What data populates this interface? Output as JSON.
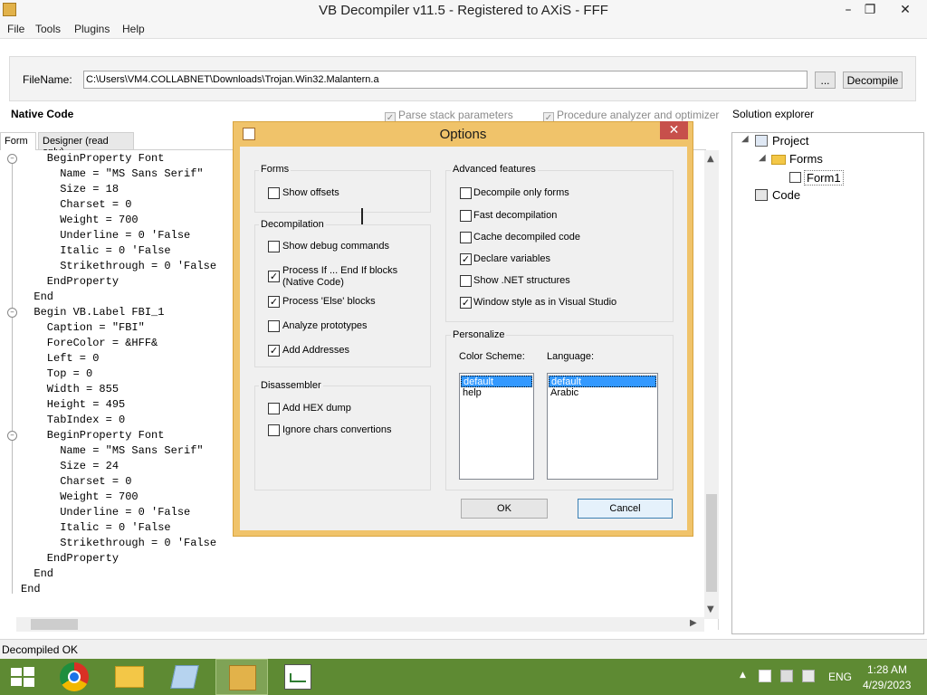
{
  "window": {
    "title": "VB Decompiler v11.5 - Registered to AXiS - FFF"
  },
  "menu": [
    "File",
    "Tools",
    "Plugins",
    "Help"
  ],
  "file_bar": {
    "label": "FileName:",
    "path": "C:\\Users\\VM4.COLLABNET\\Downloads\\Trojan.Win32.Malantern.a",
    "browse_label": "...",
    "decompile_label": "Decompile"
  },
  "header": {
    "native_code": "Native Code",
    "parse_stack": "Parse stack parameters",
    "procedure_analyzer": "Procedure analyzer and optimizer",
    "solution_explorer": "Solution explorer"
  },
  "tabs": [
    "Form",
    "Designer (read only)"
  ],
  "code_lines": [
    "    BeginProperty Font",
    "      Name = \"MS Sans Serif\"",
    "      Size = 18",
    "      Charset = 0",
    "      Weight = 700",
    "      Underline = 0 'False",
    "      Italic = 0 'False",
    "      Strikethrough = 0 'False",
    "    EndProperty",
    "  End",
    "  Begin VB.Label FBI_1",
    "    Caption = \"FBI\"",
    "    ForeColor = &HFF&",
    "    Left = 0",
    "    Top = 0",
    "    Width = 855",
    "    Height = 495",
    "    TabIndex = 0",
    "    BeginProperty Font",
    "      Name = \"MS Sans Serif\"",
    "      Size = 24",
    "      Charset = 0",
    "      Weight = 700",
    "      Underline = 0 'False",
    "      Italic = 0 'False",
    "      Strikethrough = 0 'False",
    "    EndProperty",
    "  End",
    "End"
  ],
  "tree": {
    "project": "Project",
    "forms": "Forms",
    "form1": "Form1",
    "code": "Code"
  },
  "status": "Decompiled OK",
  "taskbar": {
    "lang": "ENG",
    "time": "1:28 AM",
    "date": "4/29/2023"
  },
  "dialog": {
    "title": "Options",
    "forms": {
      "title": "Forms",
      "show_offsets": "Show offsets"
    },
    "decompilation": {
      "title": "Decompilation",
      "show_debug": "Show debug commands",
      "process_if_1": "Process If ... End If blocks",
      "process_if_2": "(Native Code)",
      "process_else": "Process 'Else' blocks",
      "analyze_prototypes": "Analyze prototypes",
      "add_addresses": "Add Addresses"
    },
    "disassembler": {
      "title": "Disassembler",
      "add_hex": "Add HEX dump",
      "ignore_chars": "Ignore chars convertions"
    },
    "advanced": {
      "title": "Advanced features",
      "decompile_only_forms": "Decompile only forms",
      "fast_decompilation": "Fast decompilation",
      "cache_code": "Cache decompiled code",
      "declare_variables": "Declare variables",
      "show_net": "Show .NET structures",
      "window_style": "Window style as in Visual Studio"
    },
    "personalize": {
      "title": "Personalize",
      "color_scheme_label": "Color Scheme:",
      "language_label": "Language:",
      "color_schemes": [
        "default",
        "help"
      ],
      "languages": [
        "default",
        "Arabic"
      ]
    },
    "ok": "OK",
    "cancel": "Cancel"
  },
  "colors": {
    "dialog_frame": "#f0c36a",
    "close": "#c7504b",
    "taskbar": "#5e8a33",
    "selection": "#3399ff"
  }
}
